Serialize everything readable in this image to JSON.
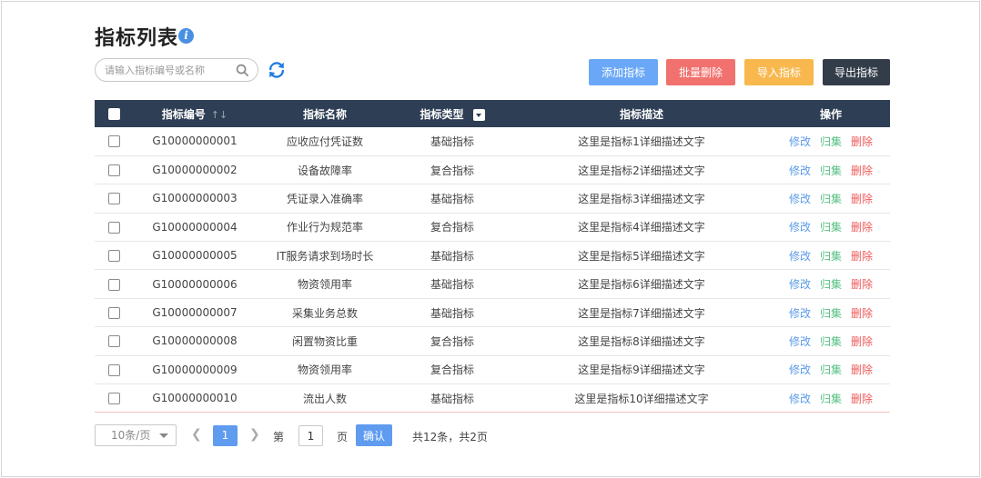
{
  "page": {
    "title": "指标列表",
    "info_icon": "info-icon"
  },
  "toolbar": {
    "search_placeholder": "请输入指标编号或名称",
    "search_value": "",
    "search_icon": "search-icon",
    "refresh_icon": "refresh-icon",
    "add_label": "添加指标",
    "batch_delete_label": "批量删除",
    "import_label": "导入指标",
    "export_label": "导出指标"
  },
  "colors": {
    "header_bg": "#2e3e54",
    "add": "#6aa8f7",
    "batch_delete": "#f0716e",
    "import": "#f8b84e",
    "export": "#333d4a",
    "edit_link": "#5a9be8",
    "collect_link": "#57c084",
    "delete_link": "#ee5a5a",
    "pager_active": "#5f9cf0"
  },
  "table": {
    "headers": {
      "code": "指标编号",
      "name": "指标名称",
      "type": "指标类型",
      "desc": "指标描述",
      "ops": "操作"
    },
    "sort_icon": "sort-icon",
    "filter_icon": "filter-dropdown-icon",
    "ops_labels": {
      "edit": "修改",
      "collect": "归集",
      "delete": "删除"
    },
    "rows": [
      {
        "code": "G10000000001",
        "name": "应收应付凭证数",
        "type": "基础指标",
        "desc": "这里是指标1详细描述文字"
      },
      {
        "code": "G10000000002",
        "name": "设备故障率",
        "type": "复合指标",
        "desc": "这里是指标2详细描述文字"
      },
      {
        "code": "G10000000003",
        "name": "凭证录入准确率",
        "type": "基础指标",
        "desc": "这里是指标3详细描述文字"
      },
      {
        "code": "G10000000004",
        "name": "作业行为规范率",
        "type": "复合指标",
        "desc": "这里是指标4详细描述文字"
      },
      {
        "code": "G10000000005",
        "name": "IT服务请求到场时长",
        "type": "基础指标",
        "desc": "这里是指标5详细描述文字"
      },
      {
        "code": "G10000000006",
        "name": "物资领用率",
        "type": "基础指标",
        "desc": "这里是指标6详细描述文字"
      },
      {
        "code": "G10000000007",
        "name": "采集业务总数",
        "type": "基础指标",
        "desc": "这里是指标7详细描述文字"
      },
      {
        "code": "G10000000008",
        "name": "闲置物资比重",
        "type": "复合指标",
        "desc": "这里是指标8详细描述文字"
      },
      {
        "code": "G10000000009",
        "name": "物资领用率",
        "type": "复合指标",
        "desc": "这里是指标9详细描述文字"
      },
      {
        "code": "G10000000010",
        "name": "流出人数",
        "type": "基础指标",
        "desc": "这里是指标10详细描述文字"
      }
    ]
  },
  "pagination": {
    "page_size": "10条/页",
    "current_page": "1",
    "goto_prefix": "第",
    "goto_value": "1",
    "goto_suffix": "页",
    "confirm_label": "确认",
    "total_text": "共12条，共2页"
  }
}
